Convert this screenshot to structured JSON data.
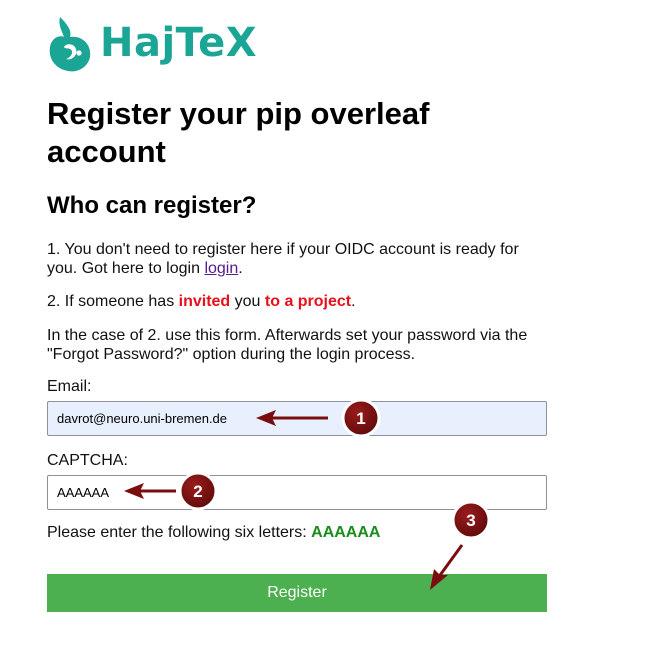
{
  "brand": {
    "name": "HajTeX",
    "color": "#1aa595",
    "logo_icon": "hajtex-fish-logo-icon"
  },
  "page": {
    "title": "Register your pip overleaf account",
    "subtitle": "Who can register?"
  },
  "info": {
    "p1_text": "1. You don't need to register here if your OIDC account is ready for you. Got here to login ",
    "p1_link": "login",
    "p1_end": ".",
    "p2_start": "2. If someone has ",
    "p2_invited": "invited",
    "p2_mid": " you ",
    "p2_project": "to a project",
    "p2_end": ".",
    "p3": "In the case of 2. use this form. Afterwards set your password via the \"Forgot Password?\" option during the login process."
  },
  "form": {
    "email_label": "Email:",
    "email_value": "davrot@neuro.uni-bremen.de",
    "captcha_label": "CAPTCHA:",
    "captcha_value": "AAAAAA",
    "captcha_instruction": "Please enter the following six letters: ",
    "captcha_code": "AAAAAA",
    "register_label": "Register"
  },
  "annotations": {
    "markers": [
      "1",
      "2",
      "3"
    ],
    "color": "#7a0e0e"
  },
  "colors": {
    "accent_red": "#e8111b",
    "code_green": "#1a8c1a",
    "button_green": "#4caf50",
    "autofill_blue": "#e8f0fe"
  }
}
